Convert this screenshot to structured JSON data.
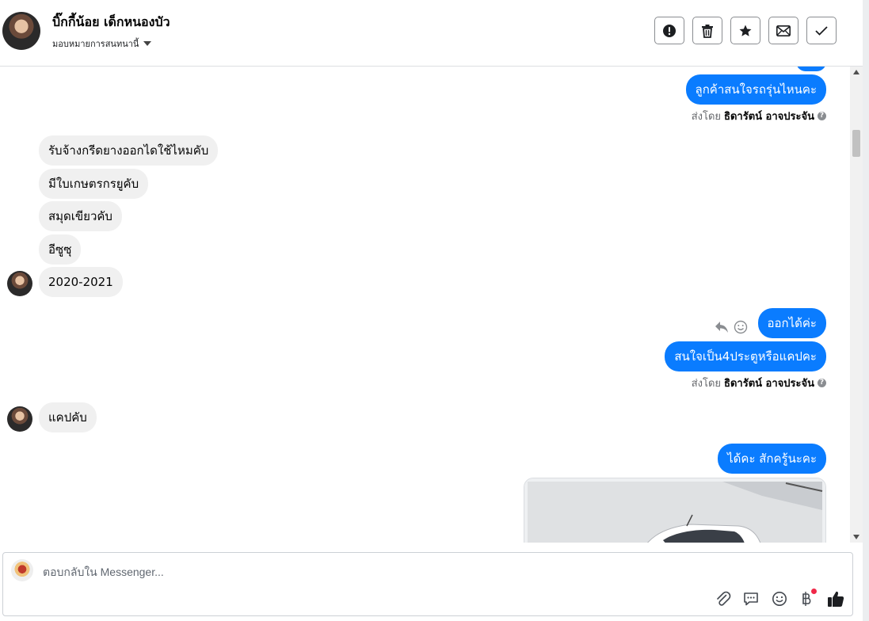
{
  "header": {
    "name": "บิ๊กกี้น้อย เด็กหนองบัว",
    "assign_label": "มอบหมายการสนทนานี้",
    "actions": [
      {
        "id": "spam",
        "icon": "exclamation-circle-icon"
      },
      {
        "id": "delete",
        "icon": "trash-icon"
      },
      {
        "id": "star",
        "icon": "star-icon"
      },
      {
        "id": "unread",
        "icon": "envelope-icon"
      },
      {
        "id": "done",
        "icon": "check-icon"
      }
    ]
  },
  "messages": {
    "out_1": "ลูกค้าสนใจรถรุ่นไหนคะ",
    "sent_by_prefix_1": "ส่งโดย",
    "sent_by_name_1": "ธิดารัตน์ อาจประจัน",
    "in_1": "รับจ้างกรีดยางออกไดใช้ไหมคับ",
    "in_2": "มีใบเกษตรกรยูคับ",
    "in_3": "สมุดเขียวคับ",
    "in_4": "อีซูซุ",
    "in_5": "2020-2021",
    "out_2": "ออกได้ค่ะ",
    "out_3": "สนใจเป็น4ประตูหรือแคปคะ",
    "sent_by_prefix_2": "ส่งโดย",
    "sent_by_name_2": "ธิดารัตน์ อาจประจัน",
    "in_6": "แคปคับ",
    "out_4": "ได้คะ สักครู้นะคะ",
    "help_glyph": "?"
  },
  "composer": {
    "placeholder": "ตอบกลับใน Messenger...",
    "tools": [
      "paperclip-icon",
      "saved-reply-icon",
      "emoji-icon",
      "baht-payment-icon",
      "thumbs-up-icon"
    ]
  },
  "colors": {
    "outgoing_bubble": "#0a7cff",
    "incoming_bubble": "#f0f0f0",
    "notification_dot": "#f02849"
  }
}
